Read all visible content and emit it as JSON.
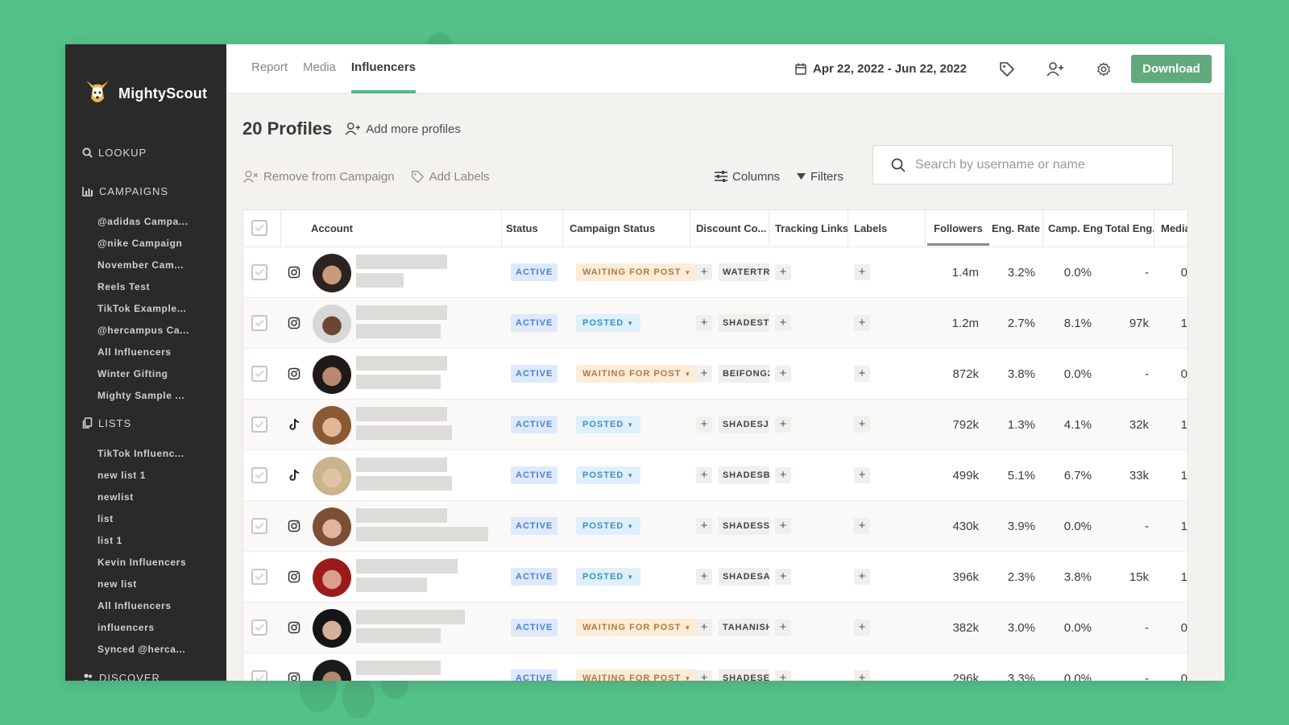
{
  "brand": {
    "name": "MightyScout",
    "accent": "#62a97d"
  },
  "sidebar": {
    "lookup_label": "LOOKUP",
    "campaigns_label": "CAMPAIGNS",
    "campaigns": [
      "@adidas Campa...",
      "@nike Campaign",
      "November Cam...",
      "Reels Test",
      "TikTok Example...",
      "@hercampus Ca...",
      "All Influencers",
      "Winter Gifting",
      "Mighty Sample ..."
    ],
    "lists_label": "LISTS",
    "lists": [
      "TikTok Influenc...",
      "new list 1",
      "newlist",
      "list",
      "list 1",
      "Kevin Influencers",
      "new list",
      "All Influencers",
      "influencers",
      "Synced @herca..."
    ],
    "discover_label": "DISCOVER"
  },
  "topbar": {
    "tabs": [
      "Report",
      "Media",
      "Influencers"
    ],
    "active_tab": "Influencers",
    "date_range": "Apr 22, 2022 - Jun 22, 2022",
    "download_label": "Download"
  },
  "header": {
    "profiles_title": "20 Profiles",
    "add_more_label": "Add more profiles",
    "remove_label": "Remove from Campaign",
    "add_labels_label": "Add Labels",
    "columns_label": "Columns",
    "filters_label": "Filters",
    "search_placeholder": "Search by username or name"
  },
  "table": {
    "columns": [
      "Account",
      "Status",
      "Campaign Status",
      "Discount Co...",
      "Tracking Links",
      "Labels",
      "Followers",
      "Eng. Rate",
      "Camp. Eng",
      "Total Eng.",
      "Media"
    ],
    "rows": [
      {
        "network": "instagram",
        "status": "ACTIVE",
        "campaign_status": "WAITING FOR POST",
        "code": "WATERTRI",
        "followers": "1.4m",
        "eng_rate": "3.2%",
        "camp_eng": "0.0%",
        "total_eng": "-",
        "media": "0"
      },
      {
        "network": "instagram",
        "status": "ACTIVE",
        "campaign_status": "POSTED",
        "code": "SHADESTO",
        "followers": "1.2m",
        "eng_rate": "2.7%",
        "camp_eng": "8.1%",
        "total_eng": "97k",
        "media": "1"
      },
      {
        "network": "instagram",
        "status": "ACTIVE",
        "campaign_status": "WAITING FOR POST",
        "code": "BEIFONG2",
        "followers": "872k",
        "eng_rate": "3.8%",
        "camp_eng": "0.0%",
        "total_eng": "-",
        "media": "0"
      },
      {
        "network": "tiktok",
        "status": "ACTIVE",
        "campaign_status": "POSTED",
        "code": "SHADESJO",
        "followers": "792k",
        "eng_rate": "1.3%",
        "camp_eng": "4.1%",
        "total_eng": "32k",
        "media": "1"
      },
      {
        "network": "tiktok",
        "status": "ACTIVE",
        "campaign_status": "POSTED",
        "code": "SHADESBI",
        "followers": "499k",
        "eng_rate": "5.1%",
        "camp_eng": "6.7%",
        "total_eng": "33k",
        "media": "1"
      },
      {
        "network": "instagram",
        "status": "ACTIVE",
        "campaign_status": "POSTED",
        "code": "SHADESSI",
        "followers": "430k",
        "eng_rate": "3.9%",
        "camp_eng": "0.0%",
        "total_eng": "-",
        "media": "1"
      },
      {
        "network": "instagram",
        "status": "ACTIVE",
        "campaign_status": "POSTED",
        "code": "SHADESAI",
        "followers": "396k",
        "eng_rate": "2.3%",
        "camp_eng": "3.8%",
        "total_eng": "15k",
        "media": "1"
      },
      {
        "network": "instagram",
        "status": "ACTIVE",
        "campaign_status": "WAITING FOR POST",
        "code": "TAHANISH",
        "followers": "382k",
        "eng_rate": "3.0%",
        "camp_eng": "0.0%",
        "total_eng": "-",
        "media": "0"
      },
      {
        "network": "instagram",
        "status": "ACTIVE",
        "campaign_status": "WAITING FOR POST",
        "code": "SHADESEL",
        "followers": "296k",
        "eng_rate": "3.3%",
        "camp_eng": "0.0%",
        "total_eng": "-",
        "media": "0"
      }
    ]
  },
  "colors": {
    "background": "#55c18a",
    "sidebar": "#2a2a2a",
    "active_badge": "#4a7fd6",
    "waiting": "#b4793a",
    "posted": "#3d8fc8"
  }
}
